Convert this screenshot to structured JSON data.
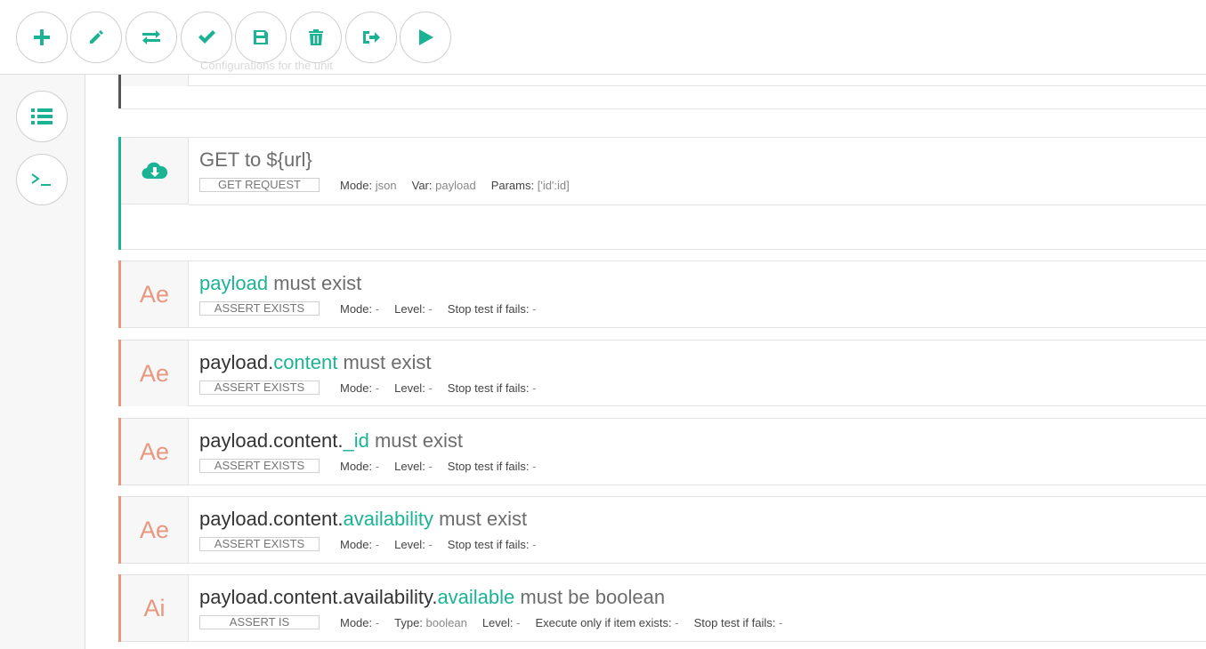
{
  "toolbar": {
    "buttons": [
      {
        "icon": "plus-icon"
      },
      {
        "icon": "pencil-icon"
      },
      {
        "icon": "swap-icon"
      },
      {
        "icon": "check-icon"
      },
      {
        "icon": "save-icon"
      },
      {
        "icon": "trash-icon"
      },
      {
        "icon": "sign-out-icon"
      },
      {
        "icon": "play-icon"
      }
    ]
  },
  "rail": {
    "buttons": [
      {
        "icon": "list-icon"
      },
      {
        "icon": "terminal-icon"
      }
    ]
  },
  "partial_step": {
    "text": "Configurations for the unit"
  },
  "colors": {
    "accent": "#1bb394",
    "assert": "#e8977e",
    "config": "#555555"
  },
  "steps": [
    {
      "type": "get",
      "icon": "cloud-download-icon",
      "title_plain": "GET to ${url}",
      "tag": "GET REQUEST",
      "meta": [
        {
          "label": "Mode:",
          "value": "json"
        },
        {
          "label": "Var:",
          "value": "payload"
        },
        {
          "label": "Params:",
          "value": "['id':id]"
        }
      ]
    },
    {
      "type": "assert",
      "glyph": "Ae",
      "title_prefix": "",
      "title_hl": "payload",
      "title_suffix": " must exist",
      "tag": "ASSERT EXISTS",
      "meta": [
        {
          "label": "Mode:",
          "value": "-"
        },
        {
          "label": "Level:",
          "value": "-"
        },
        {
          "label": "Stop test if fails:",
          "value": "-"
        }
      ]
    },
    {
      "type": "assert",
      "glyph": "Ae",
      "title_prefix": "payload.",
      "title_hl": "content",
      "title_suffix": " must exist",
      "tag": "ASSERT EXISTS",
      "meta": [
        {
          "label": "Mode:",
          "value": "-"
        },
        {
          "label": "Level:",
          "value": "-"
        },
        {
          "label": "Stop test if fails:",
          "value": "-"
        }
      ]
    },
    {
      "type": "assert",
      "glyph": "Ae",
      "title_prefix": "payload.content.",
      "title_hl": "_id",
      "title_suffix": " must exist",
      "tag": "ASSERT EXISTS",
      "meta": [
        {
          "label": "Mode:",
          "value": "-"
        },
        {
          "label": "Level:",
          "value": "-"
        },
        {
          "label": "Stop test if fails:",
          "value": "-"
        }
      ]
    },
    {
      "type": "assert",
      "glyph": "Ae",
      "title_prefix": "payload.content.",
      "title_hl": "availability",
      "title_suffix": " must exist",
      "tag": "ASSERT EXISTS",
      "meta": [
        {
          "label": "Mode:",
          "value": "-"
        },
        {
          "label": "Level:",
          "value": "-"
        },
        {
          "label": "Stop test if fails:",
          "value": "-"
        }
      ]
    },
    {
      "type": "assert",
      "glyph": "Ai",
      "title_prefix": "payload.content.availability.",
      "title_hl": "available",
      "title_suffix": " must be boolean",
      "tag": "ASSERT IS",
      "meta": [
        {
          "label": "Mode:",
          "value": "-"
        },
        {
          "label": "Type:",
          "value": "boolean"
        },
        {
          "label": "Level:",
          "value": "-"
        },
        {
          "label": "Execute only if item exists:",
          "value": "-"
        },
        {
          "label": "Stop test if fails:",
          "value": "-"
        }
      ]
    }
  ]
}
